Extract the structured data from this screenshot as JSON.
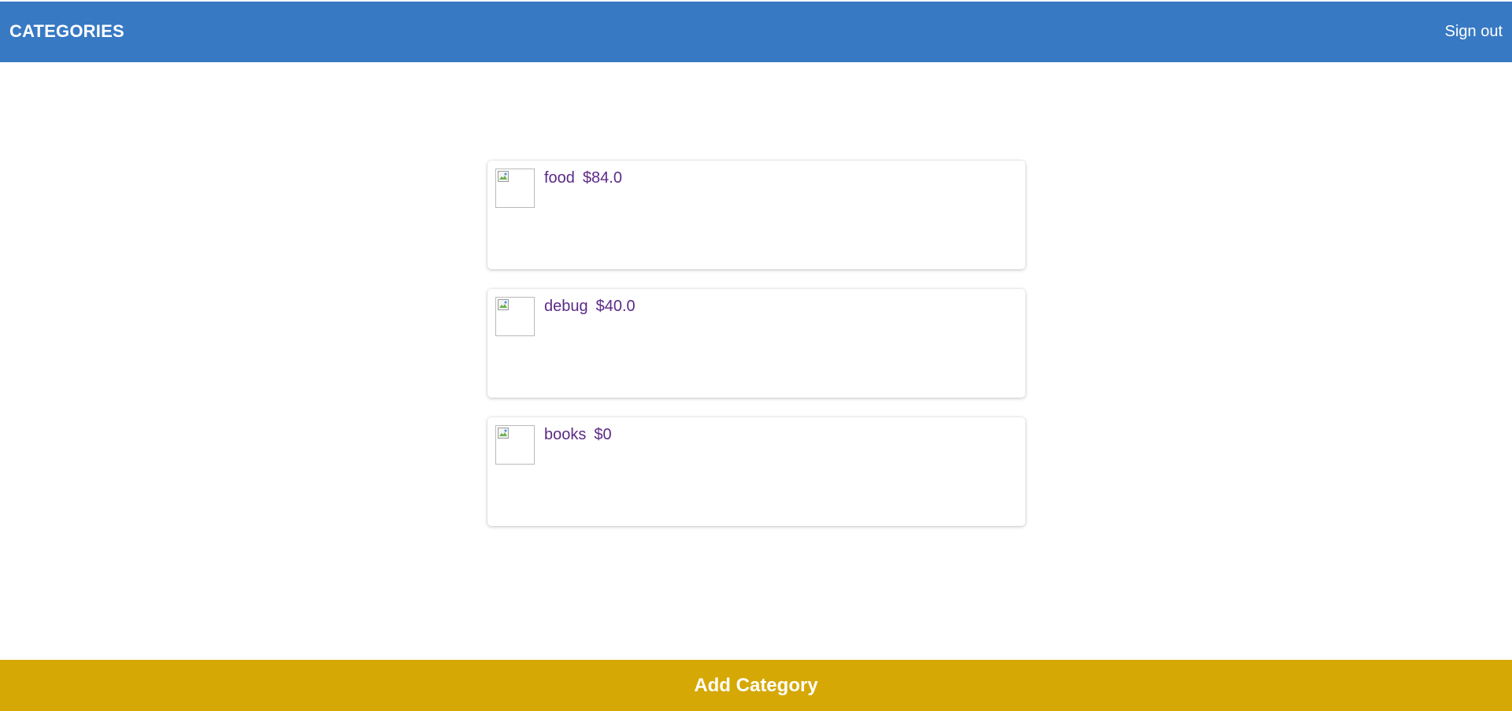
{
  "header": {
    "title": "CATEGORIES",
    "sign_out_label": "Sign out",
    "color": "#3779c3"
  },
  "categories": [
    {
      "name": "food",
      "amount": "$84.0",
      "icon": "broken-image-icon"
    },
    {
      "name": "debug",
      "amount": "$40.0",
      "icon": "broken-image-icon"
    },
    {
      "name": "books",
      "amount": "$0",
      "icon": "broken-image-icon"
    }
  ],
  "footer": {
    "add_label": "Add Category",
    "color": "#d5a806"
  },
  "colors": {
    "text_accent": "#5b2a86"
  }
}
